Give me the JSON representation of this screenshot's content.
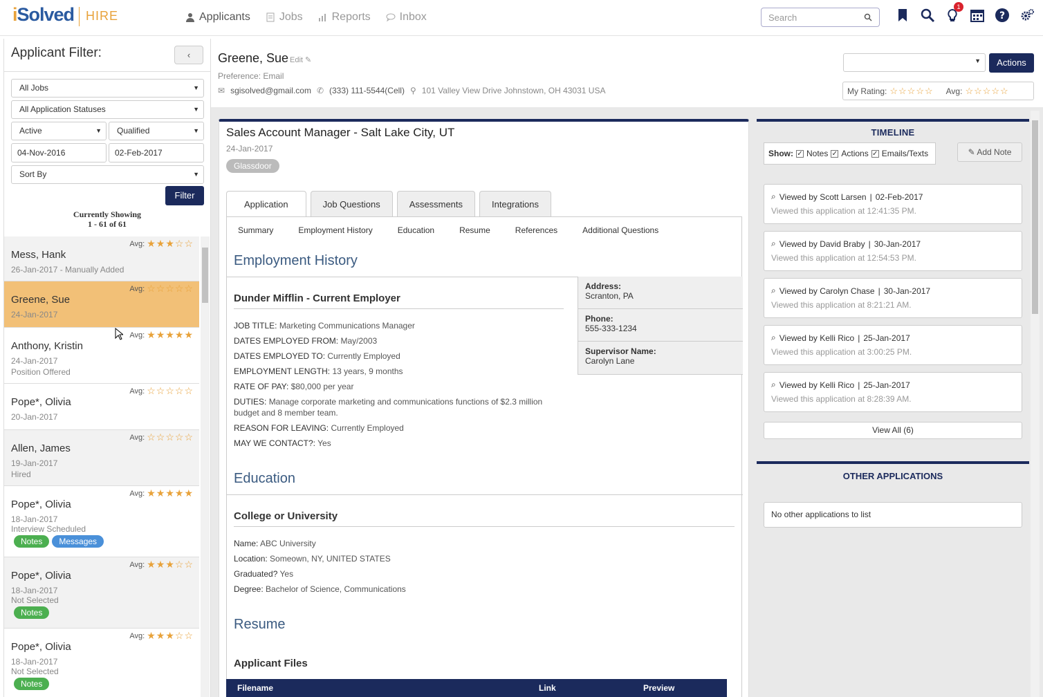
{
  "brand": {
    "logo": "iSolved",
    "product": "HIRE"
  },
  "nav": {
    "applicants": "Applicants",
    "jobs": "Jobs",
    "reports": "Reports",
    "inbox": "Inbox"
  },
  "search": {
    "placeholder": "Search"
  },
  "notifications": {
    "count": "1"
  },
  "sidebar": {
    "title": "Applicant Filter:",
    "collapse": "‹",
    "job_filter": "All Jobs",
    "status_filter": "All Application Statuses",
    "active_filter": "Active",
    "qualified_filter": "Qualified",
    "date_from": "04-Nov-2016",
    "date_to": "02-Feb-2017",
    "sort": "Sort By",
    "filter_button": "Filter",
    "showing_line1": "Currently Showing",
    "showing_line2": "1 - 61 of 61",
    "avg_label": "Avg:",
    "applicants": [
      {
        "name": "Mess, Hank",
        "date": "26-Jan-2017 - Manually Added",
        "status": "",
        "stars": "★★★☆☆",
        "pills": []
      },
      {
        "name": "Greene, Sue",
        "date": "24-Jan-2017",
        "status": "",
        "stars": "☆☆☆☆☆",
        "pills": []
      },
      {
        "name": "Anthony, Kristin",
        "date": "24-Jan-2017",
        "status": "Position Offered",
        "stars": "★★★★★",
        "pills": []
      },
      {
        "name": "Pope*, Olivia",
        "date": "20-Jan-2017",
        "status": "",
        "stars": "☆☆☆☆☆",
        "pills": []
      },
      {
        "name": "Allen, James",
        "date": "19-Jan-2017",
        "status": "Hired",
        "stars": "☆☆☆☆☆",
        "pills": []
      },
      {
        "name": "Pope*, Olivia",
        "date": "18-Jan-2017",
        "status": "Interview Scheduled",
        "stars": "★★★★★",
        "pills": [
          "Notes",
          "Messages"
        ]
      },
      {
        "name": "Pope*, Olivia",
        "date": "18-Jan-2017",
        "status": "Not Selected",
        "stars": "★★★☆☆",
        "pills": [
          "Notes"
        ]
      },
      {
        "name": "Pope*, Olivia",
        "date": "18-Jan-2017",
        "status": "Not Selected",
        "stars": "★★★☆☆",
        "pills": [
          "Notes"
        ]
      }
    ]
  },
  "applicant": {
    "name": "Greene, Sue",
    "edit": "Edit",
    "preference": "Preference: Email",
    "email": "sgisolved@gmail.com",
    "phone": "(333) 111-5544(Cell)",
    "address": "101 Valley View Drive Johnstown, OH 43031 USA",
    "actions_button": "Actions",
    "my_rating_label": "My Rating:",
    "my_rating": "☆☆☆☆☆",
    "avg_label": "Avg:",
    "avg_rating": "☆☆☆☆☆"
  },
  "job": {
    "title": "Sales Account Manager - Salt Lake City, UT",
    "date": "24-Jan-2017",
    "source": "Glassdoor",
    "tabs": [
      "Application",
      "Job Questions",
      "Assessments",
      "Integrations"
    ],
    "subtabs": [
      "Summary",
      "Employment History",
      "Education",
      "Resume",
      "References",
      "Additional Questions"
    ]
  },
  "employment": {
    "heading": "Employment History",
    "employer": "Dunder Mifflin - Current Employer",
    "fields": [
      {
        "label": "JOB TITLE:",
        "value": "Marketing Communications Manager"
      },
      {
        "label": "DATES EMPLOYED FROM:",
        "value": "May/2003"
      },
      {
        "label": "DATES EMPLOYED TO:",
        "value": "Currently Employed"
      },
      {
        "label": "EMPLOYMENT LENGTH:",
        "value": "13 years, 9 months"
      },
      {
        "label": "RATE OF PAY:",
        "value": "$80,000 per year"
      },
      {
        "label": "DUTIES:",
        "value": "Manage corporate marketing and communications functions of $2.3 million budget and 8 member team."
      },
      {
        "label": "REASON FOR LEAVING:",
        "value": "Currently Employed"
      },
      {
        "label": "MAY WE CONTACT?:",
        "value": "Yes"
      }
    ],
    "address_label": "Address:",
    "address": "Scranton, PA",
    "phone_label": "Phone:",
    "phone": "555-333-1234",
    "supervisor_label": "Supervisor Name:",
    "supervisor": "Carolyn Lane"
  },
  "education": {
    "heading": "Education",
    "type": "College or University",
    "fields": [
      {
        "label": "Name:",
        "value": "ABC University"
      },
      {
        "label": "Location:",
        "value": "Someown, NY, UNITED STATES"
      },
      {
        "label": "Graduated?",
        "value": "Yes"
      },
      {
        "label": "Degree:",
        "value": "Bachelor of Science, Communications"
      }
    ]
  },
  "resume": {
    "heading": "Resume",
    "files_heading": "Applicant Files",
    "columns": [
      "Filename",
      "Link",
      "Preview"
    ]
  },
  "timeline": {
    "title": "TIMELINE",
    "show_label": "Show:",
    "filters": [
      "Notes",
      "Actions",
      "Emails/Texts"
    ],
    "add_note": "Add Note",
    "items": [
      {
        "who": "Viewed by Scott Larsen",
        "date": "02-Feb-2017",
        "detail": "Viewed this application at 12:41:35 PM."
      },
      {
        "who": "Viewed by David Braby",
        "date": "30-Jan-2017",
        "detail": "Viewed this application at 12:54:53 PM."
      },
      {
        "who": "Viewed by Carolyn Chase",
        "date": "30-Jan-2017",
        "detail": "Viewed this application at 8:21:21 AM."
      },
      {
        "who": "Viewed by Kelli Rico",
        "date": "25-Jan-2017",
        "detail": "Viewed this application at 3:00:25 PM."
      },
      {
        "who": "Viewed by Kelli Rico",
        "date": "25-Jan-2017",
        "detail": "Viewed this application at 8:28:39 AM."
      }
    ],
    "view_all": "View All (6)"
  },
  "other_applications": {
    "title": "OTHER APPLICATIONS",
    "empty": "No other applications to list"
  },
  "colors": {
    "navy": "#1b2a5c",
    "accent": "#e8a23a",
    "selected_row": "#f2c077",
    "notes_pill": "#4caf50",
    "messages_pill": "#4a90d9",
    "heading": "#3a5a80"
  }
}
